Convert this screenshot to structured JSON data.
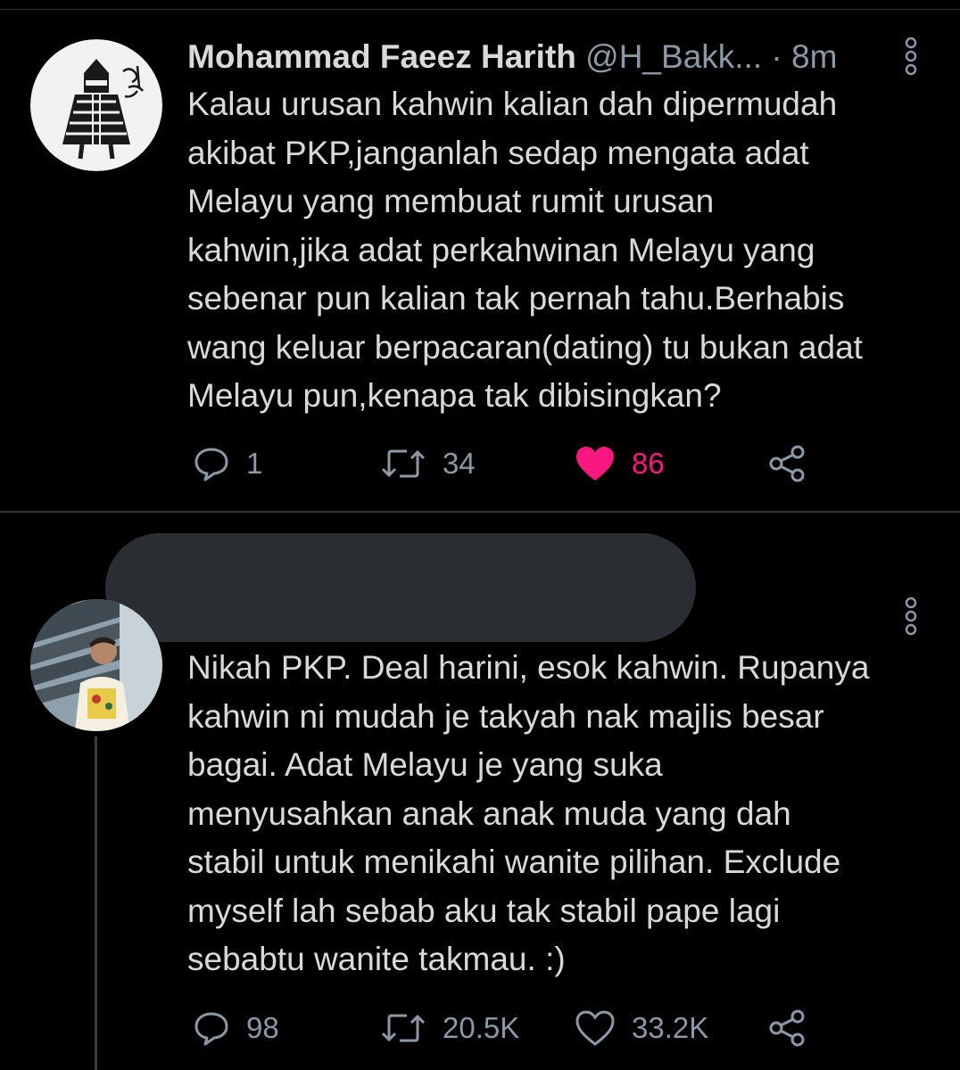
{
  "tweets": [
    {
      "display_name": "Mohammad Faeez Harith",
      "handle": "@H_Bakk...",
      "separator": "·",
      "time": "8m",
      "lines": [
        "Kalau urusan kahwin kalian dah dipermudah",
        "akibat PKP,janganlah sedap mengata adat",
        "Melayu yang membuat rumit urusan",
        "kahwin,jika adat perkahwinan Melayu yang",
        "sebenar pun kalian tak pernah tahu.Berhabis",
        "wang keluar berpacaran(dating) tu bukan adat",
        "Melayu pun,kenapa tak dibisingkan?"
      ],
      "replies": "1",
      "retweets": "34",
      "likes": "86",
      "liked": true
    },
    {
      "lines": [
        "Nikah PKP. Deal harini, esok kahwin. Rupanya",
        "kahwin ni mudah je takyah nak majlis besar",
        "bagai. Adat Melayu je yang suka",
        "menyusahkan anak anak muda yang dah",
        "stabil untuk menikahi wanite pilihan. Exclude",
        "myself lah sebab aku tak stabil pape lagi",
        "sebabtu wanite takmau. :)"
      ],
      "replies": "98",
      "retweets": "20.5K",
      "likes": "33.2K",
      "liked": false
    }
  ],
  "colors": {
    "background": "#000000",
    "text": "#d9d9d9",
    "secondary": "#8b98a5",
    "like": "#f91880",
    "divider": "#2f3336"
  },
  "icons": [
    "reply-icon",
    "retweet-icon",
    "like-icon",
    "share-icon",
    "more-icon"
  ]
}
